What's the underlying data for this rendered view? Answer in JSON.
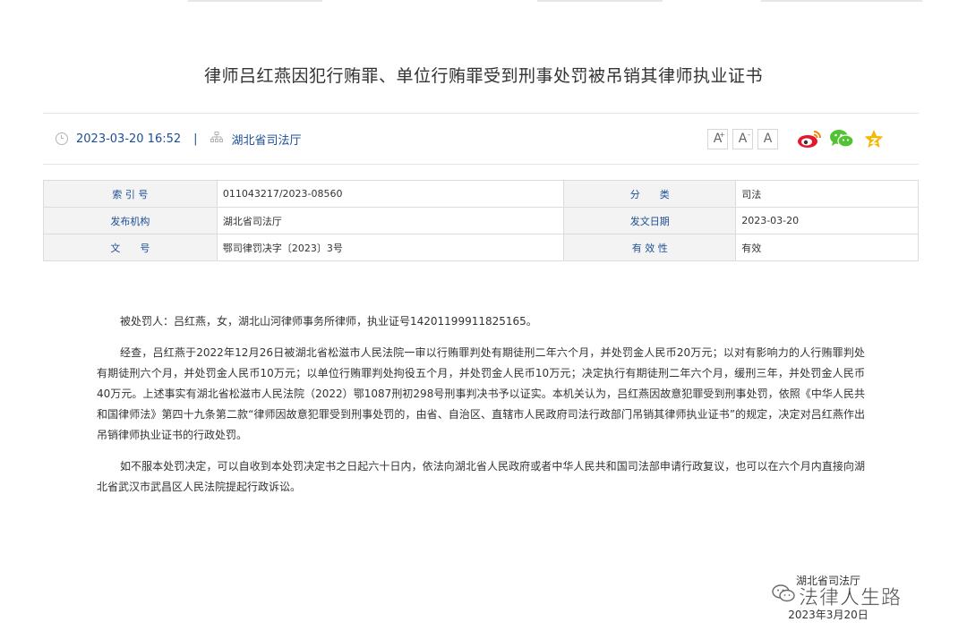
{
  "article": {
    "title": "律师吕红燕因犯行贿罪、单位行贿罪受到刑事处罚被吊销其律师执业证书",
    "datetime": "2023-03-20 16:52",
    "separator": "|",
    "source": "湖北省司法厅"
  },
  "font_tools": [
    {
      "label": "A",
      "sup": "+"
    },
    {
      "label": "A",
      "sup": "-"
    },
    {
      "label": "A",
      "sup": ""
    }
  ],
  "share_icons": [
    "weibo-icon",
    "wechat-icon",
    "favorite-star-icon"
  ],
  "info_table": {
    "rows": [
      {
        "label1": "索 引 号",
        "value1": "011043217/2023-08560",
        "label2": "分　　类",
        "value2": "司法"
      },
      {
        "label1": "发布机构",
        "value1": "湖北省司法厅",
        "label2": "发文日期",
        "value2": "2023-03-20"
      },
      {
        "label1": "文　　号",
        "value1": "鄂司律罚决字〔2023〕3号",
        "label2": "有 效 性",
        "value2": "有效"
      }
    ]
  },
  "body": {
    "paragraphs": [
      "被处罚人：吕红燕，女，湖北山河律师事务所律师，执业证号14201199911825165。",
      "经查，吕红燕于2022年12月26日被湖北省松滋市人民法院一审以行贿罪判处有期徒刑二年六个月，并处罚金人民币20万元；以对有影响力的人行贿罪判处有期徒刑六个月，并处罚金人民币10万元；以单位行贿罪判处拘役五个月，并处罚金人民币10万元；决定执行有期徒刑二年六个月，缓刑三年，并处罚金人民币40万元。上述事实有湖北省松滋市人民法院（2022）鄂1087刑初298号刑事判决书予以证实。本机关认为，吕红燕因故意犯罪受到刑事处罚，依照《中华人民共和国律师法》第四十九条第二款“律师因故意犯罪受到刑事处罚的，由省、自治区、直辖市人民政府司法行政部门吊销其律师执业证书”的规定，决定对吕红燕作出吊销律师执业证书的行政处罚。",
      "如不服本处罚决定，可以自收到本处罚决定书之日起六十日内，依法向湖北省人民政府或者中华人民共和国司法部申请行政复议，也可以在六个月内直接向湖北省武汉市武昌区人民法院提起行政诉讼。"
    ]
  },
  "signature": {
    "org": "湖北省司法厅",
    "date": "2023年3月20日"
  },
  "watermark": {
    "text": "法律人生路"
  },
  "colors": {
    "link_blue": "#1d4f95",
    "weibo_red": "#e6162d",
    "wechat_green": "#51c332",
    "star_gold": "#f5b800"
  }
}
